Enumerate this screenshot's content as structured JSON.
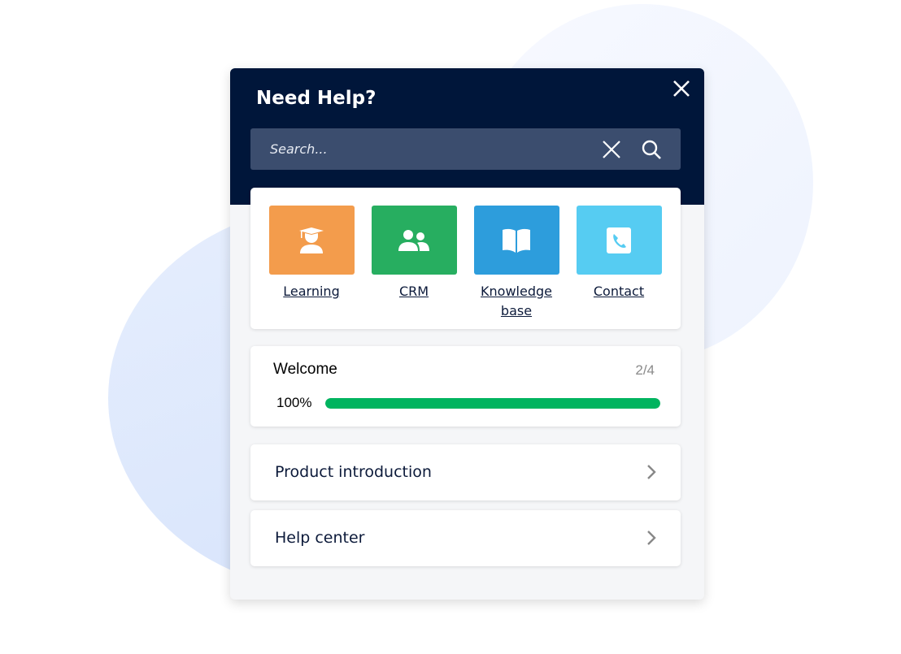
{
  "header": {
    "title": "Need Help?",
    "search_placeholder": "Search..."
  },
  "shortcuts": [
    {
      "label": "Learning",
      "icon": "graduate-icon",
      "color": "#f39c4c"
    },
    {
      "label": "CRM",
      "icon": "users-icon",
      "color": "#27ae60"
    },
    {
      "label": "Knowledge base",
      "icon": "book-icon",
      "color": "#2d9ddc"
    },
    {
      "label": "Contact",
      "icon": "phone-icon",
      "color": "#56ccf2"
    }
  ],
  "welcome": {
    "title": "Welcome",
    "step": "2/4",
    "progress_label": "100%",
    "progress": 100,
    "bar_color": "#00b45f"
  },
  "links": [
    {
      "label": "Product introduction"
    },
    {
      "label": "Help center"
    }
  ]
}
